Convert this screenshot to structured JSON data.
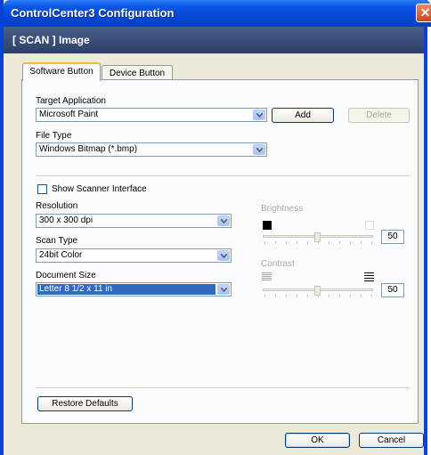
{
  "window": {
    "title": "ControlCenter3 Configuration"
  },
  "banner": {
    "text": "[ SCAN ]  Image"
  },
  "tabs": [
    {
      "label": "Software Button"
    },
    {
      "label": "Device Button"
    }
  ],
  "target_application": {
    "label": "Target Application",
    "value": "Microsoft Paint",
    "add_label": "Add",
    "delete_label": "Delete"
  },
  "file_type": {
    "label": "File Type",
    "value": "Windows Bitmap (*.bmp)"
  },
  "show_scanner_interface": {
    "label": "Show Scanner Interface",
    "checked": false
  },
  "resolution": {
    "label": "Resolution",
    "value": "300 x 300 dpi"
  },
  "scan_type": {
    "label": "Scan Type",
    "value": "24bit Color"
  },
  "document_size": {
    "label": "Document Size",
    "value": "Letter 8 1/2 x 11 in"
  },
  "brightness": {
    "label": "Brightness",
    "value": "50"
  },
  "contrast": {
    "label": "Contrast",
    "value": "50"
  },
  "restore_defaults": {
    "label": "Restore Defaults"
  },
  "footer": {
    "ok_label": "OK",
    "cancel_label": "Cancel"
  }
}
